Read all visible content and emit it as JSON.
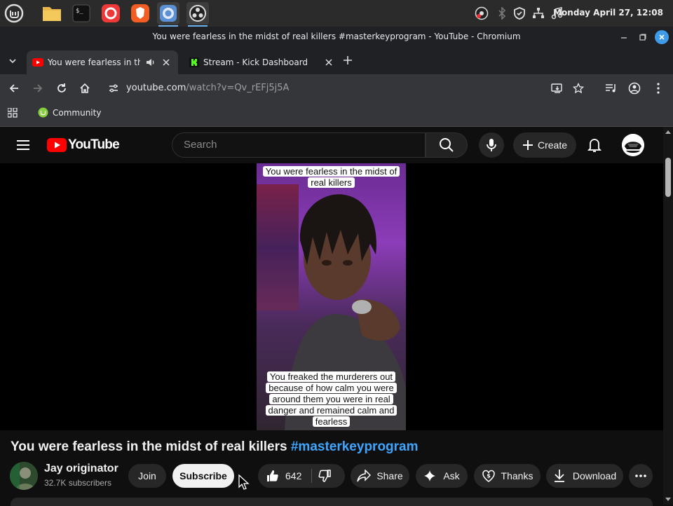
{
  "taskbar": {
    "clock": "Monday April 27, 12:08",
    "apps": [
      "mint-menu-icon",
      "files-icon",
      "terminal-icon",
      "vivaldi-icon",
      "brave-icon",
      "chromium-icon",
      "obs-icon"
    ]
  },
  "window": {
    "title": "You were fearless in the midst of real killers #masterkeyprogram - YouTube - Chromium"
  },
  "tabs": [
    {
      "label": "You were fearless in the midst of real killers",
      "active": true
    },
    {
      "label": "Stream - Kick Dashboard",
      "active": false
    }
  ],
  "address": {
    "host": "youtube.com",
    "path": "/watch?v=Qv_rEFj5j5A"
  },
  "bookmarks": [
    {
      "label": "Community"
    }
  ],
  "youtube": {
    "logo_text": "YouTube",
    "search_placeholder": "Search",
    "create_label": "Create"
  },
  "video": {
    "caption_top": "You were fearless in the midst of real killers",
    "caption_bottom": "You freaked the murderers out because of how calm you were around them you were in real danger and remained calm and fearless",
    "title_main": "You were fearless in the midst of real killers ",
    "title_hashtag": "#masterkeyprogram"
  },
  "channel": {
    "name": "Jay originator",
    "subscribers": "32.7K subscribers",
    "join_label": "Join",
    "subscribe_label": "Subscribe"
  },
  "actions": {
    "likes": "642",
    "share_label": "Share",
    "ask_label": "Ask",
    "thanks_label": "Thanks",
    "download_label": "Download"
  },
  "colors": {
    "accent_red": "#ff0000",
    "hashtag_blue": "#3ea6ff",
    "background": "#0f0f0f"
  }
}
